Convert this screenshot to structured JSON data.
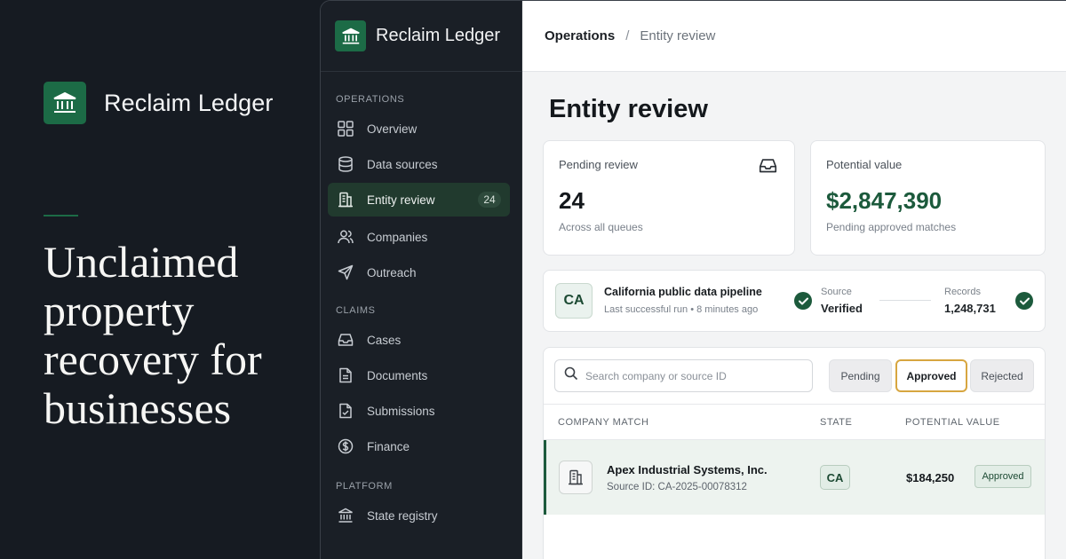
{
  "hero": {
    "brand_name": "Reclaim Ledger",
    "headline_lines": [
      "Unclaimed",
      "property",
      "recovery for",
      "businesses"
    ],
    "logo_icon": "bank-icon"
  },
  "colors": {
    "brand_green": "#1c6b46",
    "dark_bg": "#161b22",
    "sidebar_bg": "#1a1f26",
    "accent_gold": "#d7a640"
  },
  "sidebar": {
    "brand_name": "Reclaim Ledger",
    "sections": [
      {
        "label": "OPERATIONS",
        "items": [
          {
            "label": "Overview",
            "icon": "grid-icon"
          },
          {
            "label": "Data sources",
            "icon": "database-icon"
          },
          {
            "label": "Entity review",
            "icon": "building-icon",
            "badge": "24",
            "active": true
          },
          {
            "label": "Companies",
            "icon": "users-icon"
          },
          {
            "label": "Outreach",
            "icon": "send-icon"
          }
        ]
      },
      {
        "label": "CLAIMS",
        "items": [
          {
            "label": "Cases",
            "icon": "inbox-icon"
          },
          {
            "label": "Documents",
            "icon": "document-icon"
          },
          {
            "label": "Submissions",
            "icon": "file-check-icon"
          },
          {
            "label": "Finance",
            "icon": "dollar-icon"
          }
        ]
      },
      {
        "label": "PLATFORM",
        "items": [
          {
            "label": "State registry",
            "icon": "bank-icon"
          }
        ]
      }
    ]
  },
  "breadcrumb": {
    "parent": "Operations",
    "separator": "/",
    "current": "Entity review"
  },
  "page": {
    "title": "Entity review"
  },
  "stats": {
    "pending": {
      "label": "Pending review",
      "value": "24",
      "sub": "Across all queues",
      "icon": "inbox-icon"
    },
    "potential": {
      "label": "Potential value",
      "value": "$2,847,390",
      "sub": "Pending approved matches"
    }
  },
  "pipeline": {
    "code": "CA",
    "title": "California public data pipeline",
    "subtitle": "Last successful run • 8 minutes ago",
    "source_label": "Source",
    "source_value": "Verified",
    "records_label": "Records",
    "records_value": "1,248,731"
  },
  "table": {
    "search_placeholder": "Search company or source ID",
    "filters": [
      "Pending",
      "Approved",
      "Rejected"
    ],
    "active_filter": "Approved",
    "columns": [
      "COMPANY MATCH",
      "STATE",
      "POTENTIAL VALUE"
    ],
    "rows": [
      {
        "company": "Apex Industrial Systems, Inc.",
        "source": "Source ID:  CA-2025-00078312",
        "state": "CA",
        "value": "$184,250",
        "status": "Approved"
      }
    ]
  }
}
